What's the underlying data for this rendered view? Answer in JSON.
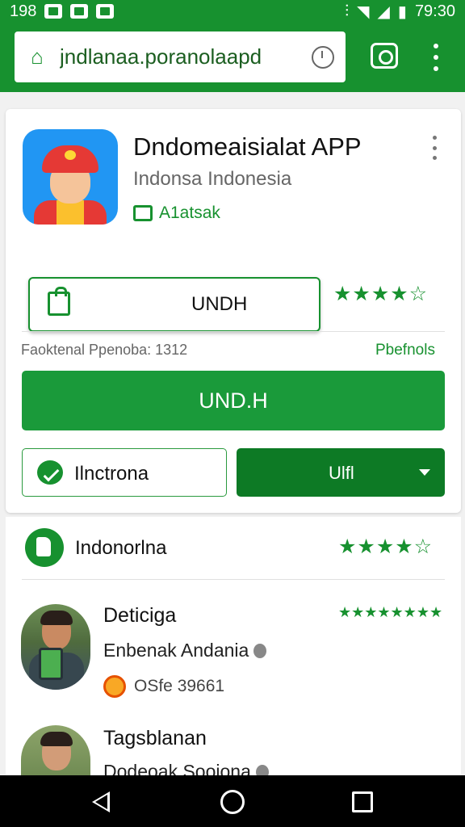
{
  "status_bar": {
    "left_text": "198",
    "time": "79:30"
  },
  "url_bar": {
    "url": "jndlanaa.poranolaapd",
    "icons": [
      "home-icon",
      "clock-icon",
      "camera-icon",
      "more-vert-icon"
    ]
  },
  "app": {
    "title": "Dndomeaisialat APP",
    "subtitle": "Indonsa Indonesia",
    "developer": "A1atsak",
    "install_label": "UNDH",
    "rating_stars": "★★★★☆",
    "meta_left": "Faoktenal Ppenoba: 1312",
    "meta_right": "Pbefnols",
    "primary_button": "UND.H",
    "message_button": "Ilnctrona",
    "dropdown_label": "Ulfl"
  },
  "rating": {
    "label": "Indonorlna",
    "stars": "★★★★☆"
  },
  "reviews": [
    {
      "name": "Deticiga",
      "subtitle": "Enbenak Andania",
      "meta": "OSfe 39661",
      "stars": "★★★★★★★★"
    },
    {
      "name": "Tagsblanan",
      "subtitle": "Dodeoak Sooiona",
      "meta": "",
      "stars": ""
    }
  ],
  "colors": {
    "brand_green": "#17912f",
    "button_green": "#1a9a3a",
    "dark_green": "#0d7a25"
  }
}
